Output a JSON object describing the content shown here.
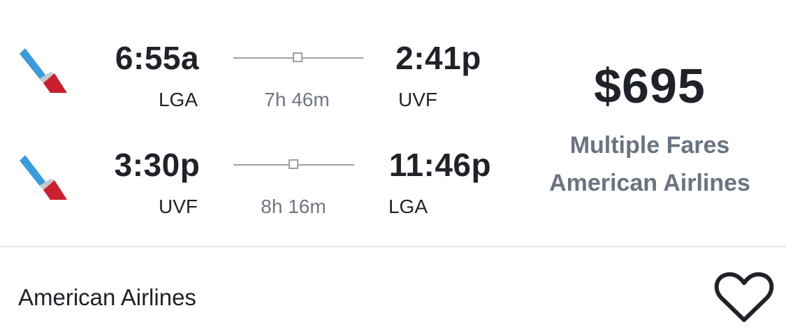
{
  "itinerary": {
    "outbound": {
      "departure_time": "6:55a",
      "departure_airport": "LGA",
      "duration": "7h 46m",
      "arrival_time": "2:41p",
      "arrival_airport": "UVF",
      "stops": 1
    },
    "inbound": {
      "departure_time": "3:30p",
      "departure_airport": "UVF",
      "duration": "8h 16m",
      "arrival_time": "11:46p",
      "arrival_airport": "LGA",
      "stops": 1
    }
  },
  "pricing": {
    "price": "$695",
    "fare_type": "Multiple Fares",
    "airline": "American Airlines"
  },
  "footer": {
    "airline_name": "American Airlines",
    "favorite_icon": "heart-outline-icon"
  },
  "colors": {
    "logo_blue": "#3b9ad9",
    "logo_red": "#c8202f",
    "logo_silver": "#c3c9cf",
    "muted_text": "#6a7480",
    "route_line": "#9aa1a9"
  }
}
